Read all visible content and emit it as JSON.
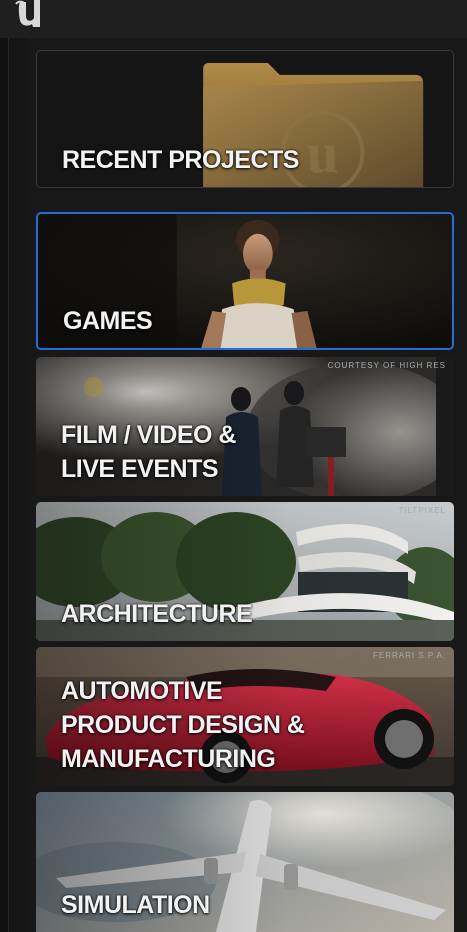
{
  "app": {
    "logo_icon": "unreal-engine-logo-icon"
  },
  "categories": [
    {
      "id": "recent",
      "label": "RECENT PROJECTS",
      "credit": "",
      "selected": false
    },
    {
      "id": "games",
      "label": "GAMES",
      "credit": "",
      "selected": true
    },
    {
      "id": "film",
      "label": "FILM / VIDEO &\nLIVE EVENTS",
      "credit": "COURTESY OF HIGH RES",
      "selected": false
    },
    {
      "id": "architecture",
      "label": "ARCHITECTURE",
      "credit": "TILTPIXEL",
      "selected": false
    },
    {
      "id": "automotive",
      "label": "AUTOMOTIVE\nPRODUCT DESIGN &\nMANUFACTURING",
      "credit": "FERRARI S.P.A.",
      "selected": false
    },
    {
      "id": "simulation",
      "label": "SIMULATION",
      "credit": "",
      "selected": false
    }
  ],
  "colors": {
    "selected_border": "#1f6fd8",
    "label_text": "#f2f2f2"
  }
}
